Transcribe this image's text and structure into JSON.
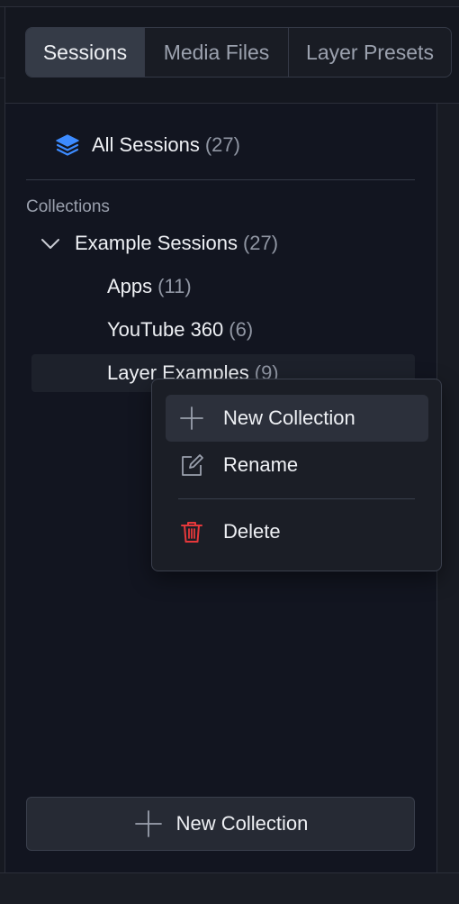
{
  "tabs": [
    {
      "label": "Sessions",
      "active": true
    },
    {
      "label": "Media Files",
      "active": false
    },
    {
      "label": "Layer Presets",
      "active": false
    }
  ],
  "all_sessions": {
    "label": "All Sessions",
    "count": "(27)",
    "icon": "layers-icon"
  },
  "collections": {
    "heading": "Collections",
    "root": {
      "label": "Example Sessions",
      "count": "(27)",
      "expanded": true
    },
    "children": [
      {
        "label": "Apps",
        "count": "(11)"
      },
      {
        "label": "YouTube 360",
        "count": "(6)"
      },
      {
        "label": "Layer Examples",
        "count": "(9)"
      }
    ]
  },
  "context_menu": {
    "items": [
      {
        "label": "New Collection",
        "icon": "plus-icon"
      },
      {
        "label": "Rename",
        "icon": "edit-icon"
      },
      {
        "label": "Delete",
        "icon": "trash-icon"
      }
    ]
  },
  "footer": {
    "new_collection_label": "New Collection"
  },
  "colors": {
    "accent_blue": "#3d8bff",
    "danger_red": "#e5383b",
    "panel_bg": "#121520",
    "menu_bg": "#1b1e26"
  }
}
